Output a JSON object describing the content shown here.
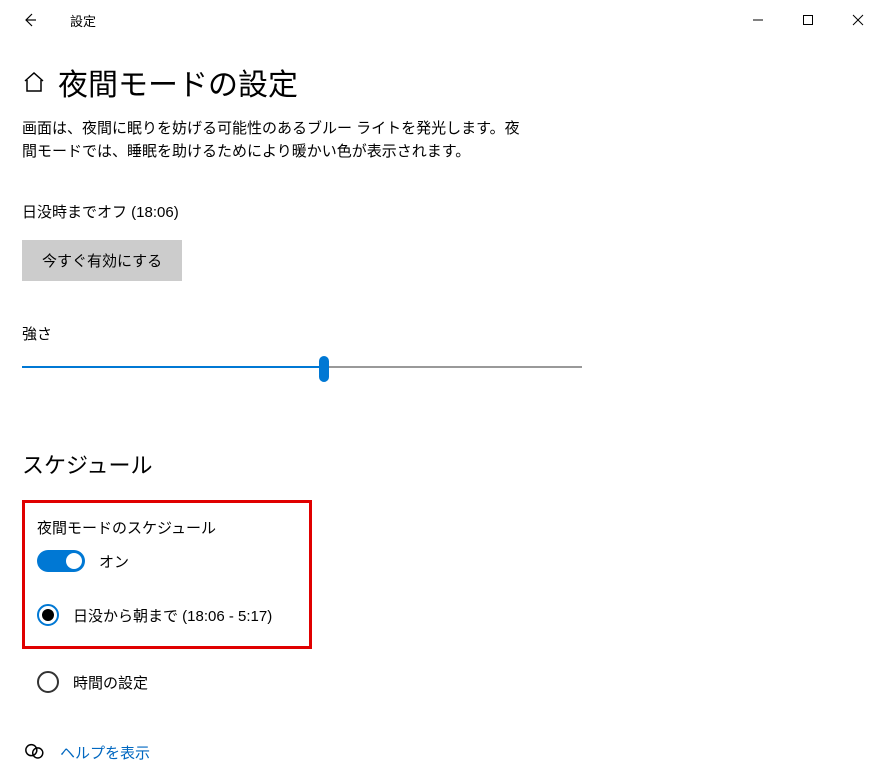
{
  "titlebar": {
    "title": "設定"
  },
  "page": {
    "title": "夜間モードの設定",
    "description": "画面は、夜間に眠りを妨げる可能性のあるブルー ライトを発光します。夜間モードでは、睡眠を助けるためにより暖かい色が表示されます。",
    "status": "日没時までオフ (18:06)",
    "enable_button": "今すぐ有効にする",
    "strength_label": "強さ",
    "slider": {
      "percent": 54
    }
  },
  "schedule": {
    "heading": "スケジュール",
    "toggle_label": "夜間モードのスケジュール",
    "toggle_state": "オン",
    "radio_sunset": "日没から朝まで (18:06 - 5:17)",
    "radio_custom": "時間の設定"
  },
  "help": {
    "label": "ヘルプを表示"
  }
}
